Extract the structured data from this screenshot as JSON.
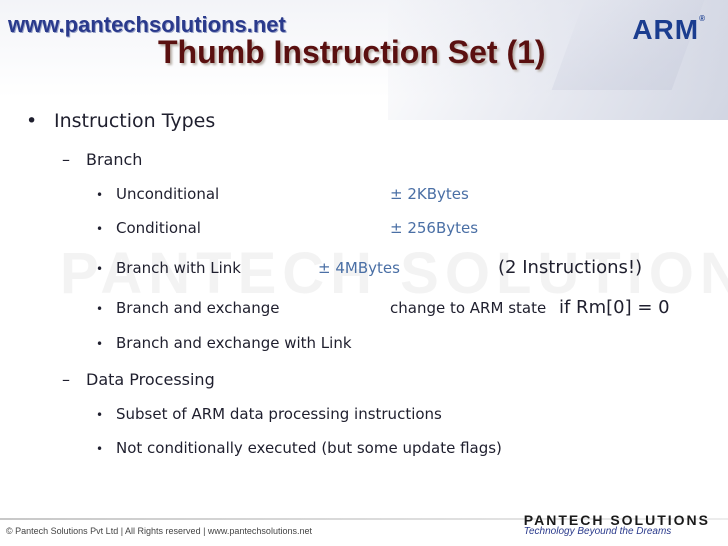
{
  "header": {
    "url": "www.pantechsolutions.net",
    "logo": "ARM",
    "title": "Thumb Instruction Set (1)"
  },
  "watermark": "PANTECH SOLUTIONS",
  "content": {
    "heading": "Instruction Types",
    "branch": {
      "label": "Branch",
      "items": [
        {
          "label": "Unconditional",
          "value": "± 2KBytes"
        },
        {
          "label": "Conditional",
          "value": "± 256Bytes"
        },
        {
          "label": "Branch with Link",
          "value": "± 4MBytes",
          "note": "(2 Instructions!)"
        },
        {
          "label": "Branch and exchange",
          "value": "change to ARM state",
          "note": "if Rm[0] = 0"
        },
        {
          "label": "Branch and exchange with Link"
        }
      ]
    },
    "data_processing": {
      "label": "Data Processing",
      "items": [
        "Subset of ARM data processing instructions",
        "Not conditionally executed (but some update flags)"
      ]
    }
  },
  "footer": {
    "copyright": "© Pantech Solutions Pvt Ltd | All Rights reserved | www.pantechsolutions.net",
    "logo_name": "PANTECH SOLUTIONS",
    "logo_tagline": "Technology Beyound the Dreams"
  },
  "colors": {
    "title": "#5a1010",
    "url": "#2a3a8c",
    "value_blue": "#4a6fa5"
  }
}
